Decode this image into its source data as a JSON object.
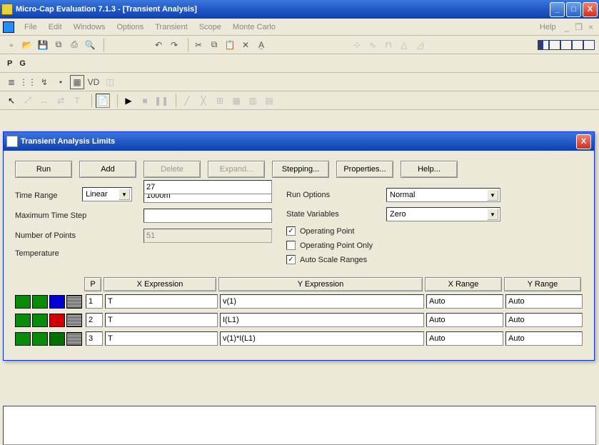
{
  "window": {
    "title": "Micro-Cap Evaluation 7.1.3 - [Transient Analysis]",
    "minimize": "_",
    "maximize": "□",
    "close": "X"
  },
  "menu": {
    "file": "File",
    "edit": "Edit",
    "windows": "Windows",
    "options": "Options",
    "transient": "Transient",
    "scope": "Scope",
    "montecarlo": "Monte Carlo",
    "help": "Help"
  },
  "pg": {
    "p": "P",
    "g": "G"
  },
  "dialog": {
    "title": "Transient Analysis Limits",
    "buttons": {
      "run": "Run",
      "add": "Add",
      "delete": "Delete",
      "expand": "Expand...",
      "stepping": "Stepping...",
      "properties": "Properties...",
      "help": "Help..."
    },
    "left": {
      "time_range_label": "Time Range",
      "time_range_value": "1000m",
      "max_step_label": "Maximum Time Step",
      "max_step_value": "",
      "num_points_label": "Number of Points",
      "num_points_value": "51",
      "temp_label": "Temperature",
      "temp_mode": "Linear",
      "temp_value": "27"
    },
    "right": {
      "run_options_label": "Run Options",
      "run_options_value": "Normal",
      "state_vars_label": "State Variables",
      "state_vars_value": "Zero",
      "op_point": "Operating Point",
      "op_point_only": "Operating Point Only",
      "auto_scale": "Auto Scale Ranges"
    },
    "headers": {
      "p": "P",
      "xe": "X Expression",
      "ye": "Y Expression",
      "xr": "X Range",
      "yr": "Y Range"
    },
    "rows": [
      {
        "colors": [
          "#0a8a0a",
          "#0a8a0a",
          "#0000d0",
          "hatch"
        ],
        "p": "1",
        "xe": "T",
        "ye": "v(1)",
        "xr": "Auto",
        "yr": "Auto"
      },
      {
        "colors": [
          "#0a8a0a",
          "#0a8a0a",
          "#d00000",
          "hatch"
        ],
        "p": "2",
        "xe": "T",
        "ye": "I(L1)",
        "xr": "Auto",
        "yr": "Auto"
      },
      {
        "colors": [
          "#0a8a0a",
          "#0a8a0a",
          "#007000",
          "hatch"
        ],
        "p": "3",
        "xe": "T",
        "ye": "v(1)*I(L1)",
        "xr": "Auto",
        "yr": "Auto"
      }
    ]
  }
}
